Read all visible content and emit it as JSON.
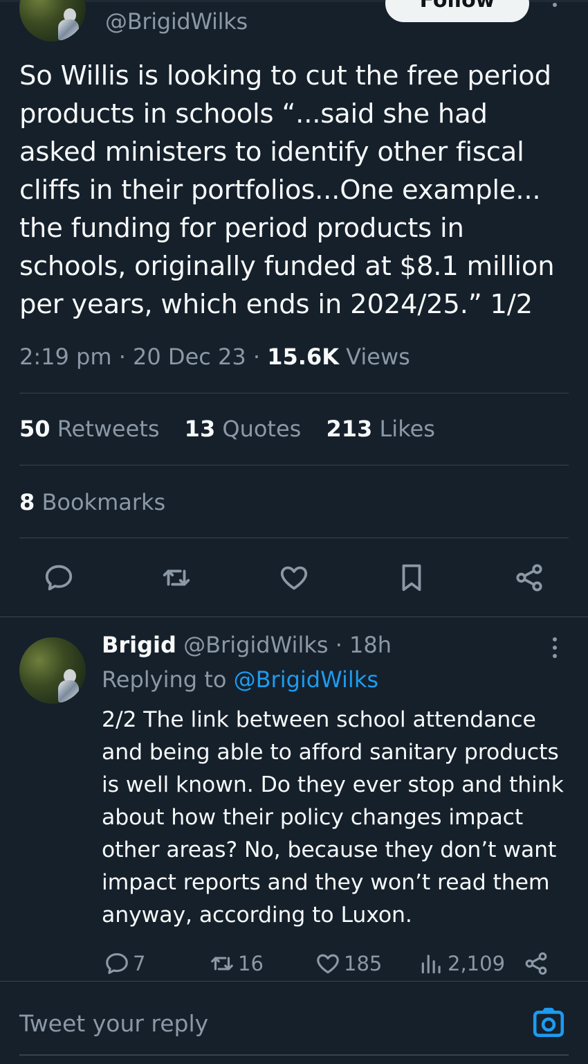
{
  "main_tweet": {
    "handle": "@BrigidWilks",
    "follow_label": "Follow",
    "text": "So Willis is looking to cut the free period products in schools “...said she had asked ministers to identify other fiscal cliffs in their portfolios...One example... the funding for period products in schools, originally funded at $8.1 million per years, which ends in 2024/25.” 1/2",
    "time": "2:19 pm",
    "date": "20 Dec 23",
    "views_count": "15.6K",
    "views_label": "Views",
    "retweets_count": "50",
    "retweets_label": "Retweets",
    "quotes_count": "13",
    "quotes_label": "Quotes",
    "likes_count": "213",
    "likes_label": "Likes",
    "bookmarks_count": "8",
    "bookmarks_label": "Bookmarks"
  },
  "reply": {
    "name": "Brigid",
    "handle": "@BrigidWilks",
    "age": "18h",
    "replying_prefix": "Replying to",
    "replying_handle": "@BrigidWilks",
    "text": "2/2 The link between school attendance and being able to afford sanitary products is well known. Do they ever stop and think about how their policy changes impact other areas? No, because they don’t want impact reports and they won’t read them anyway, according to Luxon.",
    "replies": "7",
    "retweets": "16",
    "likes": "185",
    "views": "2,109"
  },
  "composer": {
    "placeholder": "Tweet your reply"
  },
  "icons": {
    "main_actions": [
      "reply-icon",
      "retweet-icon",
      "like-icon",
      "bookmark-icon",
      "share-icon"
    ],
    "reply_actions": [
      "reply-icon",
      "retweet-icon",
      "like-icon",
      "views-icon",
      "share-icon"
    ],
    "composer": "camera-icon"
  },
  "colors": {
    "background": "#15202b",
    "text": "#f7f9f9",
    "secondary": "#8b98a5",
    "accent": "#1d9bf0",
    "divider": "#38444d"
  }
}
